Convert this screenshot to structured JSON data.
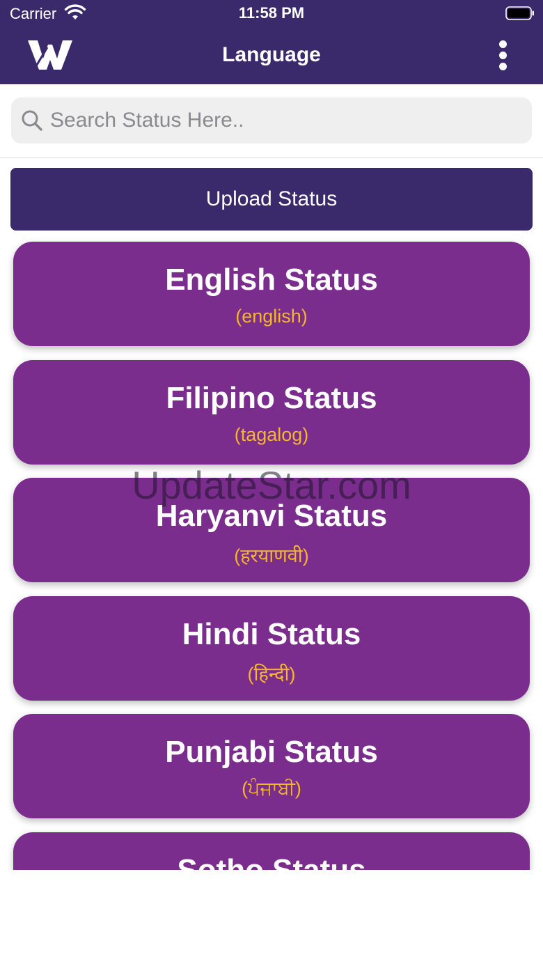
{
  "status_bar": {
    "carrier": "Carrier",
    "time": "11:58 PM"
  },
  "header": {
    "title": "Language",
    "logo_icon": "w-logo-icon",
    "menu_icon": "more-vertical-icon"
  },
  "search": {
    "placeholder": "Search Status Here..",
    "value": "",
    "icon": "search-icon"
  },
  "upload_button": {
    "label": "Upload Status"
  },
  "languages": [
    {
      "title": "English Status",
      "subtitle": "(english)"
    },
    {
      "title": "Filipino Status",
      "subtitle": "(tagalog)"
    },
    {
      "title": "Haryanvi Status",
      "subtitle": "(हरयाणवी)"
    },
    {
      "title": "Hindi Status",
      "subtitle": "(हिन्दी)"
    },
    {
      "title": "Punjabi Status",
      "subtitle": "(ਪੰਜਾਬੀ)"
    },
    {
      "title": "Sotho Status",
      "subtitle": ""
    }
  ],
  "watermark": "UpdateStar.com",
  "colors": {
    "header_bg": "#3a2a6b",
    "card_bg": "#7b2d8e",
    "subtitle": "#f5b62a",
    "upload_bg": "#3a2a6b"
  }
}
